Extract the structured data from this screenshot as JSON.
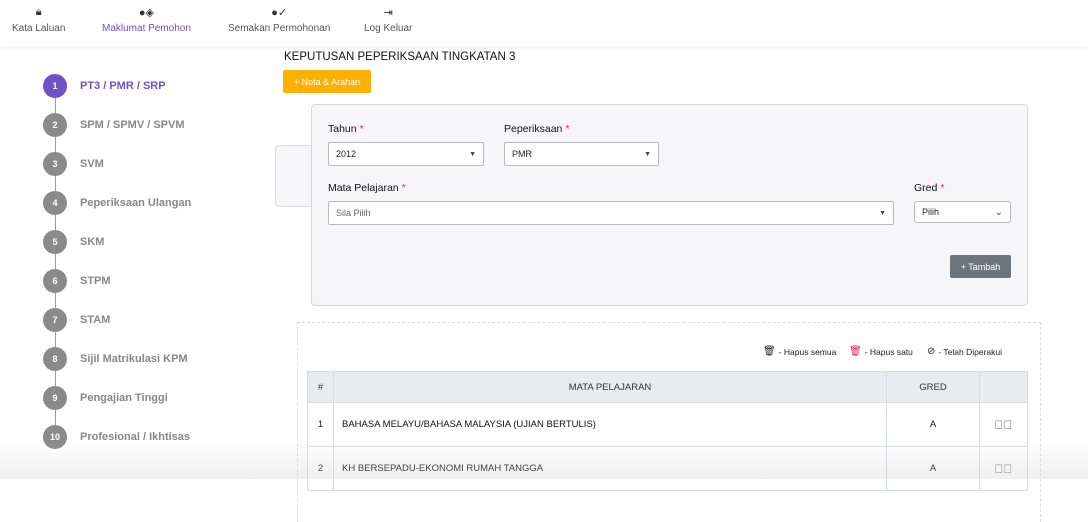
{
  "nav": [
    {
      "label": "Kata Laluan",
      "icon": "lock-icon"
    },
    {
      "label": "Maklumat Pemohon",
      "icon": "user-shield-icon"
    },
    {
      "label": "Semakan Permohonan",
      "icon": "user-check-icon"
    },
    {
      "label": "Log Keluar",
      "icon": "sign-out-icon"
    }
  ],
  "steps": [
    {
      "n": "1",
      "label": "PT3 / PMR / SRP"
    },
    {
      "n": "2",
      "label": "SPM / SPMV / SPVM"
    },
    {
      "n": "3",
      "label": "SVM"
    },
    {
      "n": "4",
      "label": "Peperiksaan Ulangan"
    },
    {
      "n": "5",
      "label": "SKM"
    },
    {
      "n": "6",
      "label": "STPM"
    },
    {
      "n": "7",
      "label": "STAM"
    },
    {
      "n": "8",
      "label": "Sijil Matrikulasi KPM"
    },
    {
      "n": "9",
      "label": "Pengajian Tinggi"
    },
    {
      "n": "10",
      "label": "Profesional / Ikhtisas"
    }
  ],
  "main": {
    "title": "KEPUTUSAN PEPERIKSAAN TINGKATAN 3",
    "nota_label": "+ Nota & Arahan"
  },
  "form": {
    "tahun_label": "Tahun",
    "tahun_value": "2012",
    "peperiksaan_label": "Peperiksaan",
    "peperiksaan_value": "PMR",
    "mata_label": "Mata Pelajaran",
    "mata_placeholder": "Sila Pilih",
    "gred_label": "Gred",
    "gred_value": "Pilih",
    "required": "*",
    "tambah_label": "+ Tambah"
  },
  "legend": {
    "hapus_semua": "- Hapus semua",
    "hapus_satu": "- Hapus satu",
    "telah": "- Telah Diperakui"
  },
  "colors": {
    "accent": "#6f52c5",
    "warning": "#ffb000",
    "danger": "#e0245e"
  },
  "table": {
    "headers": [
      "#",
      "MATA PELAJARAN",
      "GRED",
      ""
    ],
    "rows": [
      {
        "no": "1",
        "subject": "BAHASA MELAYU/BAHASA MALAYSIA (UJIAN BERTULIS)",
        "grade": "A"
      },
      {
        "no": "2",
        "subject": "KH BERSEPADU-EKONOMI RUMAH TANGGA",
        "grade": "A"
      }
    ]
  }
}
